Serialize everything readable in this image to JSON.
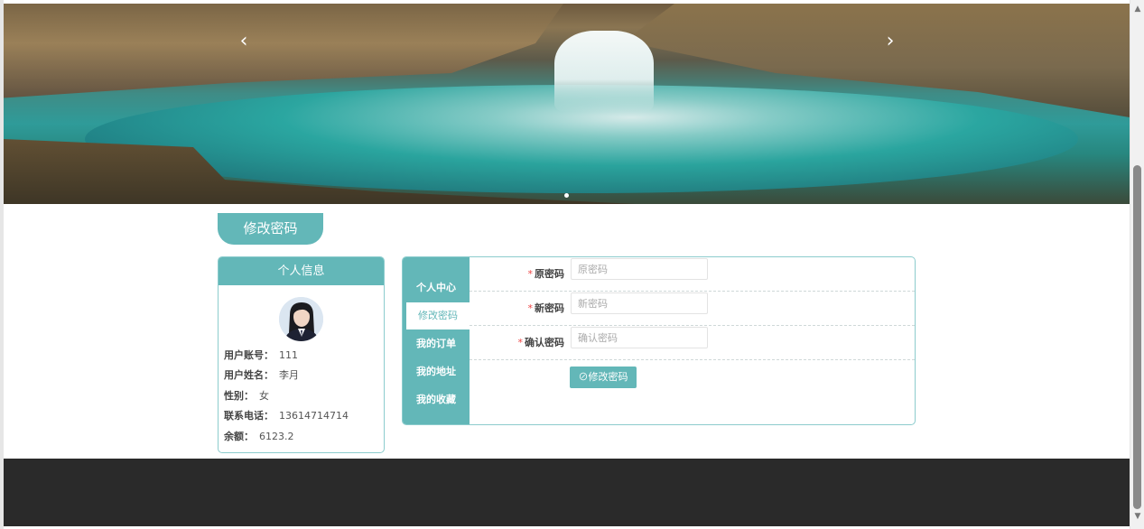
{
  "carousel": {
    "prev_icon": "chevron-left-icon",
    "next_icon": "chevron-right-icon",
    "prev_glyph": "‹",
    "next_glyph": "›"
  },
  "page": {
    "title": "修改密码"
  },
  "profile": {
    "header": "个人信息",
    "fields": [
      {
        "key": "用户账号：",
        "value": "111"
      },
      {
        "key": "用户姓名：",
        "value": "李月"
      },
      {
        "key": "性别：",
        "value": "女"
      },
      {
        "key": "联系电话：",
        "value": "13614714714"
      },
      {
        "key": "余额：",
        "value": "6123.2"
      }
    ]
  },
  "nav": {
    "items": [
      {
        "label": "个人中心"
      },
      {
        "label": "修改密码"
      },
      {
        "label": "我的订单"
      },
      {
        "label": "我的地址"
      },
      {
        "label": "我的收藏"
      }
    ],
    "active_index": 1
  },
  "form": {
    "required_mark": "*",
    "fields": [
      {
        "label": "原密码",
        "placeholder": "原密码",
        "value": ""
      },
      {
        "label": "新密码",
        "placeholder": "新密码",
        "value": ""
      },
      {
        "label": "确认密码",
        "placeholder": "确认密码",
        "value": ""
      }
    ],
    "submit_label": "⊘修改密码"
  },
  "scrollbar": {
    "up_glyph": "▲",
    "down_glyph": "▼"
  },
  "colors": {
    "accent": "#63b7b8",
    "border": "#8ccccd",
    "footer": "#2a2a2a",
    "required": "#ee4444"
  }
}
